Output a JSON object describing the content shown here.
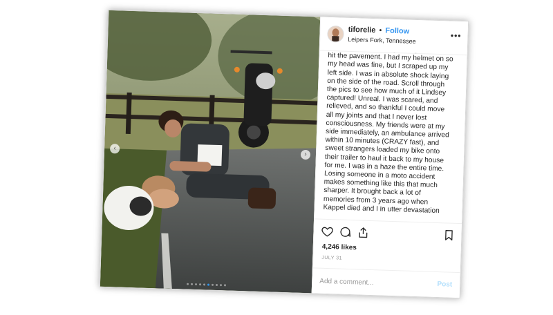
{
  "post": {
    "username": "tiforelie",
    "separator": "•",
    "follow_label": "Follow",
    "location": "Leipers Fork, Tennessee",
    "more_icon": "more-horizontal-icon",
    "caption": "the road. It slid through the grass and I hit the pavement. I had my helmet on so my head was fine, but I scraped up my left side. I was in absolute shock laying on the side of the road. Scroll through the pics to see how much of it Lindsey captured! Unreal. I was scared, and relieved, and so thankful I could move all my joints and that I never lost consciousness. My friends were at my side immediately, an ambulance arrived within 10 minutes (CRAZY fast), and sweet strangers loaded my bike onto their trailer to haul it back to my house for me. I was in a haze the entire time. Losing someone in a moto accident makes something like this that much sharper. It brought back a lot of memories from 3 years ago when Kappel died and I in utter devastation",
    "likes": "4,246 likes",
    "date": "JULY 31",
    "comment_placeholder": "Add a comment...",
    "post_label": "Post",
    "carousel": {
      "prev_glyph": "‹",
      "next_glyph": "›",
      "slide_count": 10,
      "active_index": 5
    },
    "icons": [
      "heart-icon",
      "comment-icon",
      "share-icon",
      "bookmark-icon"
    ],
    "colors": {
      "link_blue": "#3897f0",
      "post_disabled": "#b2dffc",
      "text": "#262626",
      "muted": "#999999"
    }
  }
}
